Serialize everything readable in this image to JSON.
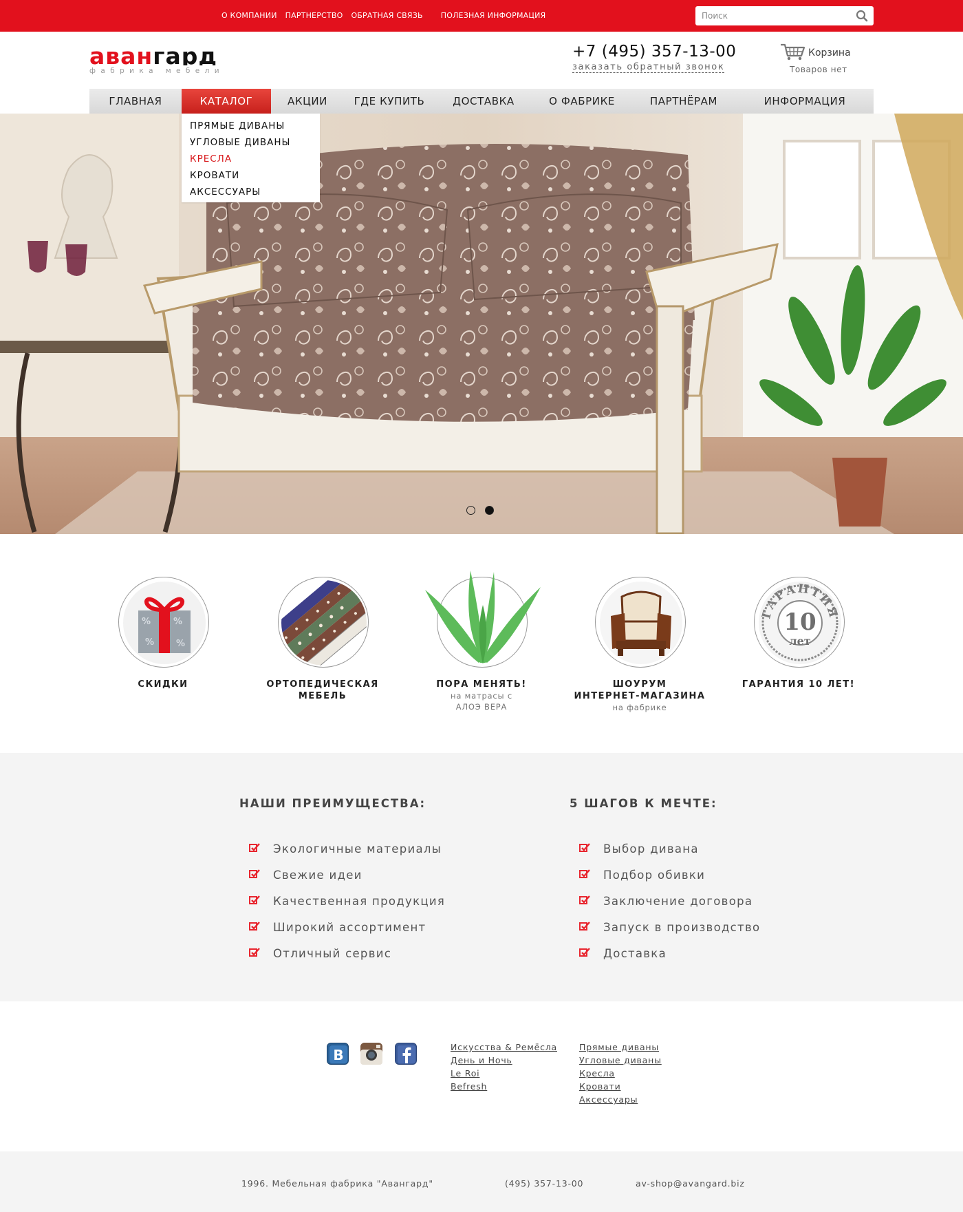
{
  "topnav": {
    "items": [
      "О КОМПАНИИ",
      "ПАРТНЕРСТВО",
      "ОБРАТНАЯ СВЯЗЬ",
      "ПОЛЕЗНАЯ ИНФОРМАЦИЯ"
    ],
    "search_placeholder": "Поиск"
  },
  "header": {
    "logo_part1": "аван",
    "logo_part2": "гард",
    "logo_subtitle": "фабрика мебели",
    "phone": "+7 (495) 357-13-00",
    "callback": "заказать обратный звонок",
    "cart_label": "Корзина",
    "cart_status": "Товаров нет"
  },
  "mainnav": {
    "items": [
      "ГЛАВНАЯ",
      "КАТАЛОГ",
      "АКЦИИ",
      "ГДЕ КУПИТЬ",
      "ДОСТАВКА",
      "О ФАБРИКЕ",
      "ПАРТНЁРАМ",
      "ИНФОРМАЦИЯ"
    ],
    "active_index": 1
  },
  "dropdown": {
    "items": [
      "ПРЯМЫЕ ДИВАНЫ",
      "УГЛОВЫЕ ДИВАНЫ",
      "КРЕСЛА",
      "КРОВАТИ",
      "АКСЕССУАРЫ"
    ],
    "highlighted_index": 2
  },
  "slider": {
    "count": 2,
    "active_index": 1
  },
  "features": [
    {
      "icon": "gift-icon",
      "title": "СКИДКИ",
      "subtitle": ""
    },
    {
      "icon": "mattress-layers-icon",
      "title": "ОРТОПЕДИЧЕСКАЯ\nМЕБЕЛЬ",
      "subtitle": ""
    },
    {
      "icon": "aloe-icon",
      "title": "ПОРА МЕНЯТЬ!",
      "subtitle": "на матрасы с\nАЛОЭ ВЕРА"
    },
    {
      "icon": "armchair-icon",
      "title": "ШОУРУМ\nИНТЕРНЕТ-МАГАЗИНА",
      "subtitle": "на фабрике"
    },
    {
      "icon": "warranty-stamp-icon",
      "title": "ГАРАНТИЯ 10 ЛЕТ!",
      "subtitle": "",
      "stamp_top": "ГАРАНТИЯ",
      "stamp_number": "10",
      "stamp_bottom": "лет"
    }
  ],
  "advantages": {
    "title": "НАШИ ПРЕИМУЩЕСТВА:",
    "items": [
      "Экологичные материалы",
      "Свежие идеи",
      "Качественная продукция",
      "Широкий ассортимент",
      "Отличный сервис"
    ]
  },
  "steps": {
    "title": "5 ШАГОВ К МЕЧТЕ:",
    "items": [
      "Выбор дивана",
      "Подбор обивки",
      "Заключение договора",
      "Запуск в производство",
      "Доставка"
    ]
  },
  "social": {
    "vk_letter": "B"
  },
  "footer_links": {
    "brands": [
      "Искусства & Ремёсла ",
      "День и Ночь ",
      "Le Roi ",
      "Befresh"
    ],
    "catalog": [
      "Прямые диваны",
      "Угловые диваны",
      "Кресла",
      "Кровати",
      "Аксессуары"
    ]
  },
  "bottom": {
    "copyright": "1996. Мебельная фабрика \"Авангард\"",
    "phone": "(495) 357-13-00",
    "email": "av-shop@avangard.biz"
  },
  "colors": {
    "brand_red": "#e2111d",
    "checkbox_red": "#e8262f",
    "aloe_green": "#5dbb5a"
  }
}
